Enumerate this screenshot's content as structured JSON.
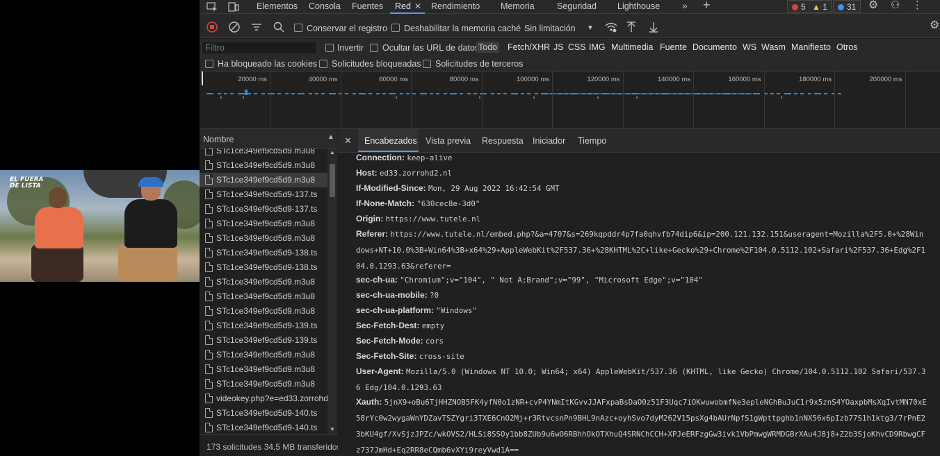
{
  "video": {
    "overlay_line1": "EL FUERA",
    "overlay_line2": "DE LISTA"
  },
  "tabbar": {
    "tabs": [
      "Elementos",
      "Consola",
      "Fuentes",
      "Red",
      "Rendimiento",
      "Memoria",
      "Seguridad",
      "Lighthouse"
    ],
    "active_tab": "Red",
    "errors": "5",
    "warnings": "1",
    "messages": "31",
    "colors": {
      "error": "#e0413a",
      "warning": "#f2c94c",
      "info": "#3e8ef7",
      "accent": "#4da0ff"
    }
  },
  "toolbar": {
    "preserve_log": "Conservar el registro",
    "disable_cache": "Deshabilitar la memoria caché",
    "throttling": "Sin limitación"
  },
  "filters": {
    "placeholder": "Filtro",
    "invert": "Invertir",
    "hide_data_urls": "Ocultar las URL de datos",
    "types": [
      "Todo",
      "Fetch/XHR",
      "JS",
      "CSS",
      "IMG",
      "Multimedia",
      "Fuente",
      "Documento",
      "WS",
      "Wasm",
      "Manifiesto",
      "Otros"
    ],
    "blocked_cookies": "Ha bloqueado las cookies",
    "blocked_requests": "Solicitudes bloqueadas",
    "third_party": "Solicitudes de terceros"
  },
  "timeline": {
    "ticks": [
      "20000 ms",
      "40000 ms",
      "60000 ms",
      "80000 ms",
      "100000 ms",
      "120000 ms",
      "140000 ms",
      "160000 ms",
      "180000 ms",
      "200000 ms",
      "2"
    ]
  },
  "requests": {
    "column_name": "Nombre",
    "items": [
      "STc1ce349ef9cd5d9.m3u8",
      "STc1ce349ef9cd5d9.m3u8",
      "STc1ce349ef9cd5d9.m3u8",
      "STc1ce349ef9cd5d9-137.ts",
      "STc1ce349ef9cd5d9-137.ts",
      "STc1ce349ef9cd5d9.m3u8",
      "STc1ce349ef9cd5d9.m3u8",
      "STc1ce349ef9cd5d9-138.ts",
      "STc1ce349ef9cd5d9-138.ts",
      "STc1ce349ef9cd5d9.m3u8",
      "STc1ce349ef9cd5d9.m3u8",
      "STc1ce349ef9cd5d9.m3u8",
      "STc1ce349ef9cd5d9-139.ts",
      "STc1ce349ef9cd5d9-139.ts",
      "STc1ce349ef9cd5d9.m3u8",
      "STc1ce349ef9cd5d9.m3u8",
      "STc1ce349ef9cd5d9.m3u8",
      "videokey.php?e=ed33.zorrohd2",
      "STc1ce349ef9cd5d9-140.ts",
      "STc1ce349ef9cd5d9-140.ts"
    ],
    "selected_index": 2,
    "status": "173 solicitudes  34.5 MB transferidos"
  },
  "details": {
    "tabs": [
      "Encabezados",
      "Vista previa",
      "Respuesta",
      "Iniciador",
      "Tiempo"
    ],
    "active_tab": "Encabezados",
    "headers": [
      {
        "k": "Connection:",
        "v": "keep-alive"
      },
      {
        "k": "Host:",
        "v": "ed33.zorrohd2.nl"
      },
      {
        "k": "If-Modified-Since:",
        "v": "Mon, 29 Aug 2022 16:42:54 GMT"
      },
      {
        "k": "If-None-Match:",
        "v": "\"630cec8e-3d0\""
      },
      {
        "k": "Origin:",
        "v": "https://www.tutele.nl"
      },
      {
        "k": "Referer:",
        "v": "https://www.tutele.nl/embed.php?&a=4707&s=269kqpddr4p7fa0qhvfb74dip6&ip=200.121.132.151&useragent=Mozilla%2F5.0+%28Windows+NT+10.0%3B+Win64%3B+x64%29+AppleWebKit%2F537.36+%28KHTML%2C+like+Gecko%29+Chrome%2F104.0.5112.102+Safari%2F537.36+Edg%2F104.0.1293.63&referer="
      },
      {
        "k": "sec-ch-ua:",
        "v": "\"Chromium\";v=\"104\", \" Not A;Brand\";v=\"99\", \"Microsoft Edge\";v=\"104\""
      },
      {
        "k": "sec-ch-ua-mobile:",
        "v": "?0"
      },
      {
        "k": "sec-ch-ua-platform:",
        "v": "\"Windows\""
      },
      {
        "k": "Sec-Fetch-Dest:",
        "v": "empty"
      },
      {
        "k": "Sec-Fetch-Mode:",
        "v": "cors"
      },
      {
        "k": "Sec-Fetch-Site:",
        "v": "cross-site"
      },
      {
        "k": "User-Agent:",
        "v": "Mozilla/5.0 (Windows NT 10.0; Win64; x64) AppleWebKit/537.36 (KHTML, like Gecko) Chrome/104.0.5112.102 Safari/537.36 Edg/104.0.1293.63"
      },
      {
        "k": "Xauth:",
        "v": "5jnX9+oBu6TjHHZNOB5FK4yfN0o1zNR+cvP4YNmItKGvvJJAFxpaBsDaO0z51F3Uqc7iOKwuwobmfNe3epleNGhBuJuC1r9x5znS4YOaxpbMsXqIvtMN70xE58rYc0w2wygaWnYDZavTSZYgri3TXE6CnO2Mj+r3RtvcsnPn9BHL9nAzc+oyhSvo7dyM262V15psXg4bAUrNpfS1gWpttpghb1nNX56x6pIzb77S1h1ktg3/7rPnE23bKU4gf/XvSjzJPZc/wkOVS2/HLSi8SSOy1bb8ZUb9u6wO6RBhhOkOTXhuQ4SRNChCCH+XPJeERFzgGw3ivk1VbPmwgWRMDGBrXAu4J8j8+Z2b3SjoKhvCD9RbwgCFz737JmHd+Eq2RR8eCQmb6vXYi9reyVwd1A=="
      }
    ]
  }
}
